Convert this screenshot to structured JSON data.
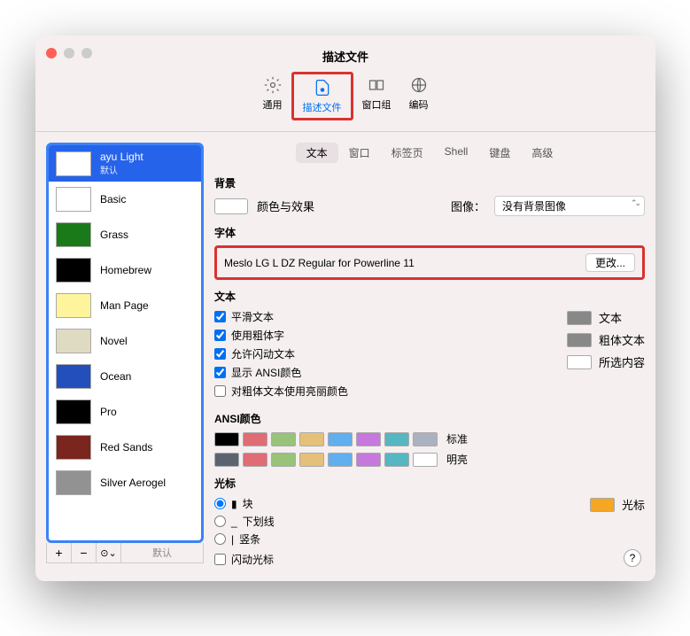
{
  "window": {
    "title": "描述文件"
  },
  "toolbar": {
    "general": "通用",
    "profiles": "描述文件",
    "groups": "窗口组",
    "encodings": "编码"
  },
  "profiles": [
    {
      "name": "ayu Light",
      "sub": "默认",
      "thumb": "#ffffff"
    },
    {
      "name": "Basic",
      "thumb": "#ffffff"
    },
    {
      "name": "Grass",
      "thumb": "#1a7a1a"
    },
    {
      "name": "Homebrew",
      "thumb": "#000000"
    },
    {
      "name": "Man Page",
      "thumb": "#fef49c"
    },
    {
      "name": "Novel",
      "thumb": "#dfdbc3"
    },
    {
      "name": "Ocean",
      "thumb": "#224fbc"
    },
    {
      "name": "Pro",
      "thumb": "#000000"
    },
    {
      "name": "Red Sands",
      "thumb": "#7a251e"
    },
    {
      "name": "Silver Aerogel",
      "thumb": "#929292"
    }
  ],
  "sidebar_actions": {
    "add": "+",
    "remove": "−",
    "menu": "⊙⌄",
    "default": "默认"
  },
  "tabs": [
    "文本",
    "窗口",
    "标签页",
    "Shell",
    "键盘",
    "高级"
  ],
  "sections": {
    "background": "背景",
    "font": "字体",
    "text": "文本",
    "ansi": "ANSI颜色",
    "cursor": "光标"
  },
  "background": {
    "color_label": "颜色与效果",
    "image_label": "图像：",
    "image_select": "没有背景图像"
  },
  "font": {
    "name": "Meslo LG L DZ Regular for Powerline 11",
    "change": "更改..."
  },
  "text_opts": {
    "smooth": "平滑文本",
    "bold": "使用粗体字",
    "blink": "允许闪动文本",
    "ansi": "显示 ANSI颜色",
    "bright": "对粗体文本使用亮丽颜色"
  },
  "text_swatches": {
    "text": "文本",
    "bold_text": "粗体文本",
    "selection": "所选内容"
  },
  "ansi": {
    "normal": "标准",
    "bright": "明亮",
    "normal_colors": [
      "#000000",
      "#e06c75",
      "#98c379",
      "#e5c07b",
      "#61afef",
      "#c678dd",
      "#56b6c2",
      "#abb2bf"
    ],
    "bright_colors": [
      "#5c6370",
      "#e06c75",
      "#98c379",
      "#e5c07b",
      "#61afef",
      "#c678dd",
      "#56b6c2",
      "#ffffff"
    ]
  },
  "cursor": {
    "block": "块",
    "underline": "下划线",
    "bar": "竖条",
    "blink": "闪动光标",
    "swatch_label": "光标",
    "swatch_color": "#f5a623"
  },
  "help": "?"
}
